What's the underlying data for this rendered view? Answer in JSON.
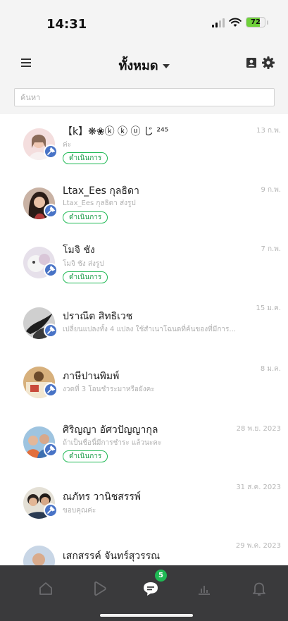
{
  "status_bar": {
    "time": "14:31",
    "battery": "72",
    "battery_level": 0.72
  },
  "header": {
    "title": "ทั้งหมด"
  },
  "search": {
    "placeholder": "ค้นหา"
  },
  "colors": {
    "accent": "#1fb954",
    "pin": "#4873c6",
    "tabbar": "#3a3a3c"
  },
  "chats": [
    {
      "name": "【k】❋❀ⓚ ⓚ ⓤ じ ²⁴⁵",
      "preview": "ค่ะ",
      "tag": "ดำเนินการ",
      "date": "13 ก.พ."
    },
    {
      "name": "Ltax_Ees กุลธิดา",
      "preview": "Ltax_Ees กุลธิดา ส่งรูป",
      "tag": "ดำเนินการ",
      "date": "9 ก.พ."
    },
    {
      "name": "โมจิ ชัง",
      "preview": "โมจิ ชัง ส่งรูป",
      "tag": "ดำเนินการ",
      "date": "7 ก.พ."
    },
    {
      "name": "ปราณีต สิทธิเวช",
      "preview": "เปลี่ยนแปลงทั้ง 4 แปลง ใช้สำเนาโฉนดที่ค้นของที่มีการ...",
      "tag": "",
      "date": "15 ม.ค."
    },
    {
      "name": "ภาษีปานพิมพ์",
      "preview": "งวดที่ 3 โอนชำระมาหรือยังคะ",
      "tag": "",
      "date": "8 ม.ค."
    },
    {
      "name": "ศิริญญา อัศวปัญญากุล",
      "preview": "ถ้าเป็นชื่อนี้มีการชำระ แล้วนะคะ",
      "tag": "ดำเนินการ",
      "date": "28 พ.ย. 2023"
    },
    {
      "name": "ณภัทร วานิชสรรพ์",
      "preview": "ขอบคุณค่ะ",
      "tag": "",
      "date": "31 ส.ค. 2023"
    },
    {
      "name": "เสกสรรค์ จันทร์สุวรรณ",
      "preview": "",
      "tag": "",
      "date": "29 พ.ค. 2023"
    }
  ],
  "tabbar": {
    "tabs": [
      {
        "icon": "home-icon"
      },
      {
        "icon": "play-icon"
      },
      {
        "icon": "chat-icon",
        "badge": "5"
      },
      {
        "icon": "stats-icon"
      },
      {
        "icon": "bell-icon"
      }
    ]
  }
}
